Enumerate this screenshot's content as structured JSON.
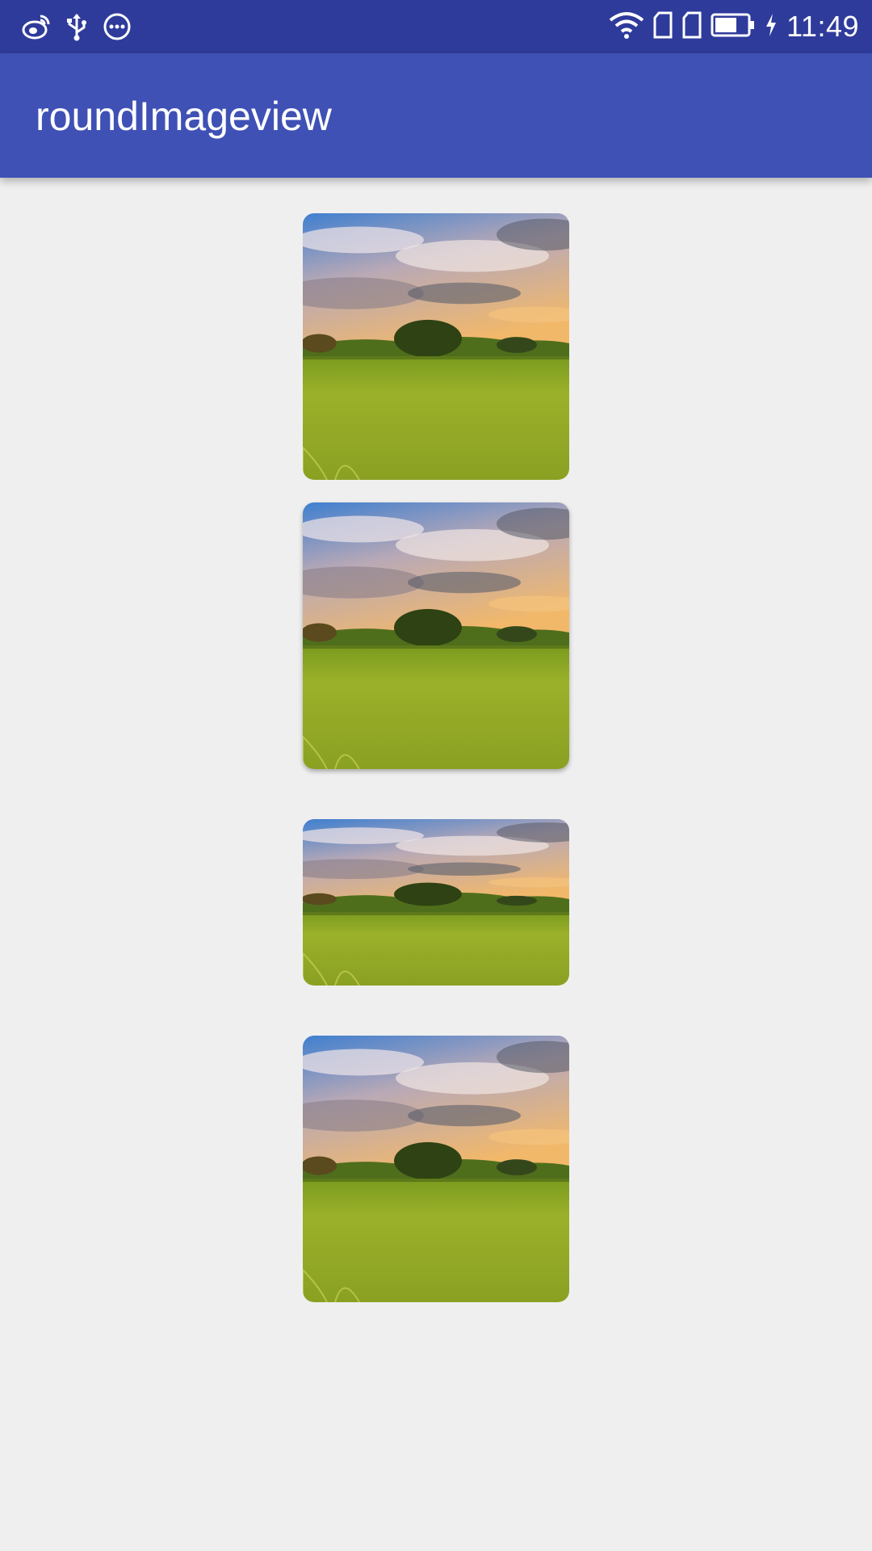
{
  "status_bar": {
    "time": "11:49",
    "left_icons": [
      "weibo-icon",
      "usb-icon",
      "more-dots-icon"
    ],
    "right_icons": [
      "wifi-icon",
      "sim-card-icon",
      "sim-card-icon",
      "battery-icon",
      "charging-icon"
    ],
    "background": "#2f3b9b"
  },
  "app_bar": {
    "title": "roundImageview",
    "background": "#3f51b5"
  },
  "images": [
    {
      "name": "landscape-image",
      "description_icon": "landscape-photo",
      "elevated": false
    },
    {
      "name": "landscape-image",
      "description_icon": "landscape-photo",
      "elevated": true
    },
    {
      "name": "landscape-image",
      "description_icon": "landscape-photo",
      "elevated": false
    },
    {
      "name": "landscape-image",
      "description_icon": "landscape-photo",
      "elevated": false
    }
  ],
  "colors": {
    "page_background": "#efefef",
    "sky_top": "#3f7fd0",
    "horizon": "#f2b86a",
    "grass": "#9bb12a"
  }
}
